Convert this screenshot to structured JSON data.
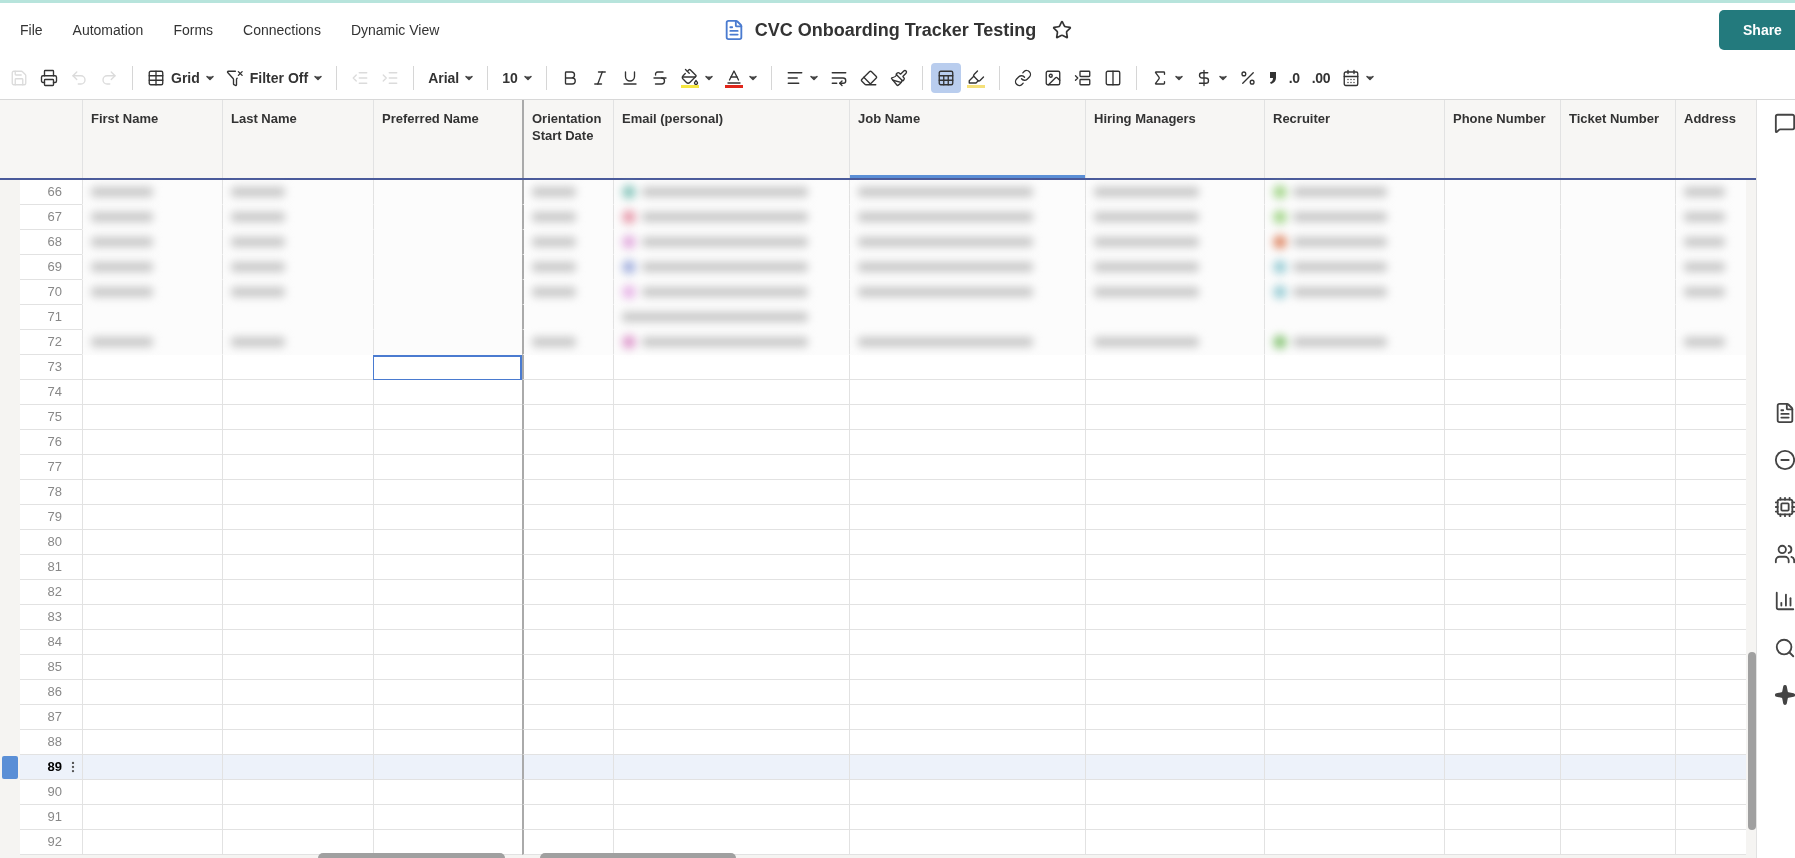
{
  "menu": [
    "File",
    "Automation",
    "Forms",
    "Connections",
    "Dynamic View"
  ],
  "title": "CVC Onboarding Tracker Testing",
  "starred": false,
  "share_button": "Share",
  "toolbar": [
    {
      "kind": "save",
      "disabled": true,
      "selected": false
    },
    {
      "kind": "print",
      "disabled": false,
      "selected": false
    },
    {
      "kind": "undo",
      "disabled": true,
      "selected": false
    },
    {
      "kind": "redo",
      "disabled": true,
      "selected": false
    },
    {
      "kind": "separator"
    },
    {
      "kind": "grid",
      "label": "Grid",
      "disabled": false,
      "selected": false,
      "has_menu": true
    },
    {
      "kind": "filter",
      "label": "Filter Off",
      "disabled": false,
      "selected": false,
      "has_menu": true
    },
    {
      "kind": "separator"
    },
    {
      "kind": "outdent",
      "disabled": true,
      "selected": false
    },
    {
      "kind": "indent",
      "disabled": true,
      "selected": false
    },
    {
      "kind": "separator"
    },
    {
      "kind": "font",
      "label": "Arial",
      "disabled": false,
      "selected": false,
      "has_menu": true
    },
    {
      "kind": "separator"
    },
    {
      "kind": "size",
      "label": "10",
      "disabled": false,
      "selected": false,
      "has_menu": true
    },
    {
      "kind": "separator"
    },
    {
      "kind": "bold",
      "disabled": false,
      "selected": false
    },
    {
      "kind": "italic",
      "disabled": false,
      "selected": false
    },
    {
      "kind": "underline",
      "disabled": false,
      "selected": false
    },
    {
      "kind": "strike",
      "disabled": false,
      "selected": false
    },
    {
      "kind": "fill",
      "disabled": false,
      "selected": false,
      "has_menu": true,
      "color": "#f5e642"
    },
    {
      "kind": "textcolor",
      "disabled": false,
      "selected": false,
      "has_menu": true,
      "color": "#e0261b"
    },
    {
      "kind": "separator"
    },
    {
      "kind": "align",
      "disabled": false,
      "selected": false,
      "has_menu": true
    },
    {
      "kind": "wrap",
      "disabled": false,
      "selected": false
    },
    {
      "kind": "clear",
      "disabled": false,
      "selected": false
    },
    {
      "kind": "painter",
      "disabled": false,
      "selected": false
    },
    {
      "kind": "separator"
    },
    {
      "kind": "gridlines",
      "disabled": false,
      "selected": true
    },
    {
      "kind": "highlight",
      "disabled": false,
      "selected": false,
      "color": "#f5e07a"
    },
    {
      "kind": "separator"
    },
    {
      "kind": "link",
      "disabled": false,
      "selected": false
    },
    {
      "kind": "image",
      "disabled": false,
      "selected": false
    },
    {
      "kind": "insertrow",
      "disabled": false,
      "selected": false
    },
    {
      "kind": "insertcol",
      "disabled": false,
      "selected": false
    },
    {
      "kind": "separator"
    },
    {
      "kind": "sum",
      "disabled": false,
      "selected": false,
      "has_menu": true
    },
    {
      "kind": "currency",
      "disabled": false,
      "selected": false,
      "has_menu": true
    },
    {
      "kind": "percent",
      "disabled": false,
      "selected": false
    },
    {
      "kind": "comma",
      "disabled": false,
      "selected": false
    },
    {
      "kind": "decrease",
      "label": ".0",
      "disabled": false,
      "selected": false
    },
    {
      "kind": "increase",
      "label": ".00",
      "disabled": false,
      "selected": false
    },
    {
      "kind": "date",
      "disabled": false,
      "selected": false,
      "has_menu": true
    }
  ],
  "columns": [
    {
      "label": "First Name",
      "selected": false,
      "has_cursor": false
    },
    {
      "label": "Last Name",
      "selected": false,
      "has_cursor": false
    },
    {
      "label": "Preferred Name",
      "selected": false,
      "has_cursor": true
    },
    {
      "label": "Orientation Start Date",
      "selected": false,
      "has_cursor": false
    },
    {
      "label": "Email (personal)",
      "selected": false,
      "has_cursor": false
    },
    {
      "label": "Job Name",
      "selected": true,
      "has_cursor": false
    },
    {
      "label": "Hiring Managers",
      "selected": false,
      "has_cursor": false
    },
    {
      "label": "Recruiter",
      "selected": false,
      "has_cursor": false
    },
    {
      "label": "Phone Number",
      "selected": false,
      "has_cursor": false
    },
    {
      "label": "Ticket Number",
      "selected": false,
      "has_cursor": false
    },
    {
      "label": "Address",
      "selected": false,
      "has_cursor": false
    }
  ],
  "rows": [
    {
      "number": "66",
      "blurred": true,
      "selected": false,
      "has_cursor": false
    },
    {
      "number": "67",
      "blurred": true,
      "selected": false,
      "has_cursor": false
    },
    {
      "number": "68",
      "blurred": true,
      "selected": false,
      "has_cursor": false
    },
    {
      "number": "69",
      "blurred": true,
      "selected": false,
      "has_cursor": false
    },
    {
      "number": "70",
      "blurred": true,
      "selected": false,
      "has_cursor": false
    },
    {
      "number": "71",
      "blurred": true,
      "selected": false,
      "has_cursor": false
    },
    {
      "number": "72",
      "blurred": true,
      "selected": false,
      "has_cursor": false
    },
    {
      "number": "73",
      "blurred": false,
      "selected": false,
      "has_cursor": true
    },
    {
      "number": "74",
      "blurred": false,
      "selected": false,
      "has_cursor": false
    },
    {
      "number": "75",
      "blurred": false,
      "selected": false,
      "has_cursor": false
    },
    {
      "number": "76",
      "blurred": false,
      "selected": false,
      "has_cursor": false
    },
    {
      "number": "77",
      "blurred": false,
      "selected": false,
      "has_cursor": false
    },
    {
      "number": "78",
      "blurred": false,
      "selected": false,
      "has_cursor": false
    },
    {
      "number": "79",
      "blurred": false,
      "selected": false,
      "has_cursor": false
    },
    {
      "number": "80",
      "blurred": false,
      "selected": false,
      "has_cursor": false
    },
    {
      "number": "81",
      "blurred": false,
      "selected": false,
      "has_cursor": false
    },
    {
      "number": "82",
      "blurred": false,
      "selected": false,
      "has_cursor": false
    },
    {
      "number": "83",
      "blurred": false,
      "selected": false,
      "has_cursor": false
    },
    {
      "number": "84",
      "blurred": false,
      "selected": false,
      "has_cursor": false
    },
    {
      "number": "85",
      "blurred": false,
      "selected": false,
      "has_cursor": false
    },
    {
      "number": "86",
      "blurred": false,
      "selected": false,
      "has_cursor": false
    },
    {
      "number": "87",
      "blurred": false,
      "selected": false,
      "has_cursor": false
    },
    {
      "number": "88",
      "blurred": false,
      "selected": false,
      "has_cursor": false
    },
    {
      "number": "89",
      "blurred": false,
      "selected": true,
      "has_cursor": false
    },
    {
      "number": "90",
      "blurred": false,
      "selected": false,
      "has_cursor": false
    },
    {
      "number": "91",
      "blurred": false,
      "selected": false,
      "has_cursor": false
    },
    {
      "number": "92",
      "blurred": false,
      "selected": false,
      "has_cursor": false
    }
  ]
}
